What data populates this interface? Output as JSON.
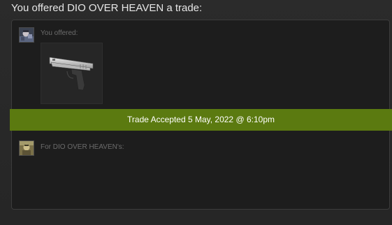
{
  "header": {
    "title": "You offered DIO OVER HEAVEN a trade:"
  },
  "trade": {
    "offered_label": "You offered:",
    "for_label": "For DIO OVER HEAVEN's:",
    "status": "Trade Accepted 5 May, 2022 @ 6:10pm",
    "offered_items": [
      {
        "icon": "pistol-item-icon"
      }
    ]
  },
  "colors": {
    "status_banner": "#5b7a10",
    "panel_background": "#1d1d1d",
    "page_background": "#2a2a2a"
  }
}
